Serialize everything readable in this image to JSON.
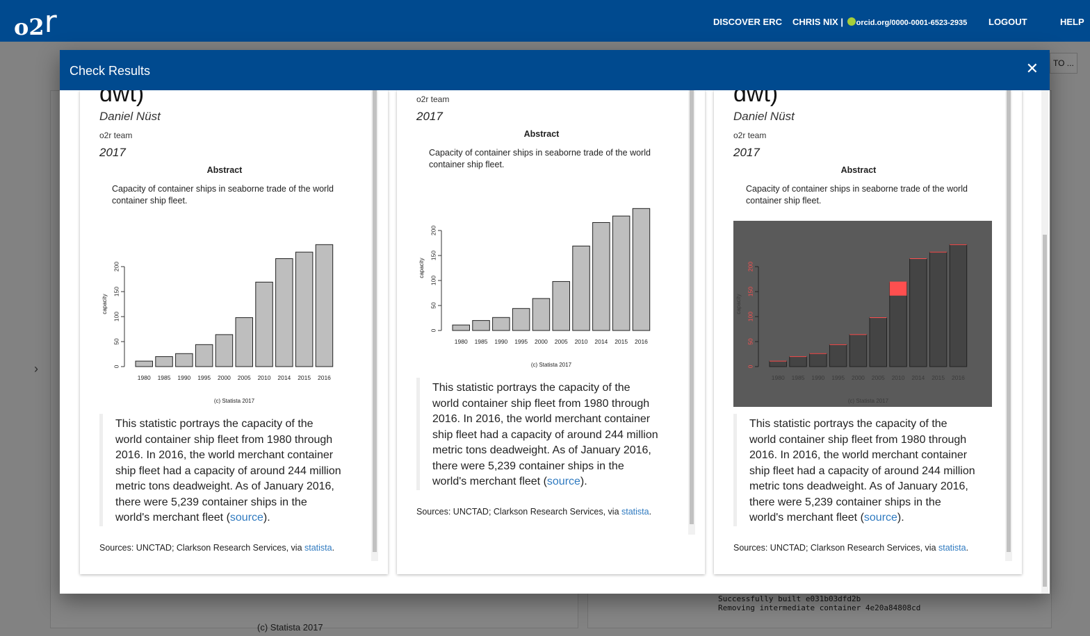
{
  "appbar": {
    "logo": "o2",
    "logo_r": "r",
    "discover": "DISCOVER ERC",
    "user": "CHRIS NIX |",
    "orcid": "orcid.org/0000-0001-6523-2935",
    "logout": "LOGOUT",
    "help": "HELP"
  },
  "background": {
    "button_label": "TO ...",
    "side_arrow": "›",
    "log_lines": [
      "Successfully built e031b03dfd2b",
      "Removing intermediate container 4e20a84808cd"
    ],
    "caption": "(c) Statista 2017"
  },
  "dialog": {
    "title": "Check Results",
    "close": "✕"
  },
  "paper": {
    "title_fragment": "dwt)",
    "author": "Daniel Nüst",
    "affiliation": "o2r team",
    "year": "2017",
    "abstract_heading": "Abstract",
    "abstract": "Capacity of container ships in seaborne trade of the world container ship fleet.",
    "quote_text": "This statistic portrays the capacity of the world container ship fleet from 1980 through 2016. In 2016, the world merchant container ship fleet had a capacity of around 244 million metric tons deadweight. As of January 2016, there were 5,239 container ships in the world's merchant fleet (",
    "quote_link": "source",
    "quote_end": ").",
    "sources_prefix": "Sources: UNCTAD; Clarkson Research Services, via ",
    "sources_link": "statista",
    "sources_end": "."
  },
  "chart_data": [
    {
      "type": "bar",
      "categories": [
        "1980",
        "1985",
        "1990",
        "1995",
        "2000",
        "2005",
        "2010",
        "2014",
        "2015",
        "2016"
      ],
      "values": [
        11,
        20,
        26,
        44,
        64,
        98,
        169,
        216,
        229,
        244
      ],
      "ylabel": "capacity",
      "yticks": [
        0,
        50,
        100,
        150,
        200
      ],
      "ylim": [
        0,
        250
      ],
      "caption": "(c) Statista 2017",
      "bar_color": "#bebebe"
    },
    {
      "type": "bar",
      "categories": [
        "1980",
        "1985",
        "1990",
        "1995",
        "2000",
        "2005",
        "2010",
        "2014",
        "2015",
        "2016"
      ],
      "values": [
        11,
        20,
        26,
        44,
        64,
        98,
        169,
        216,
        229,
        244
      ],
      "ylabel": "capacity",
      "yticks": [
        0,
        50,
        100,
        150,
        200
      ],
      "ylim": [
        0,
        250
      ],
      "caption": "(c) Statista 2017",
      "bar_color": "#bebebe"
    },
    {
      "type": "bar",
      "categories": [
        "1980",
        "1985",
        "1990",
        "1995",
        "2000",
        "2005",
        "2010",
        "2014",
        "2015",
        "2016"
      ],
      "values": [
        11,
        20,
        26,
        44,
        64,
        98,
        169,
        216,
        229,
        244
      ],
      "ylabel": "capacity",
      "yticks": [
        0,
        50,
        100,
        150,
        200
      ],
      "ylim": [
        0,
        250
      ],
      "caption": "(c) Statista 2017",
      "bar_color": "#444444",
      "diff_color": "#ff4f4f",
      "diff_range": [
        142,
        170
      ]
    }
  ]
}
